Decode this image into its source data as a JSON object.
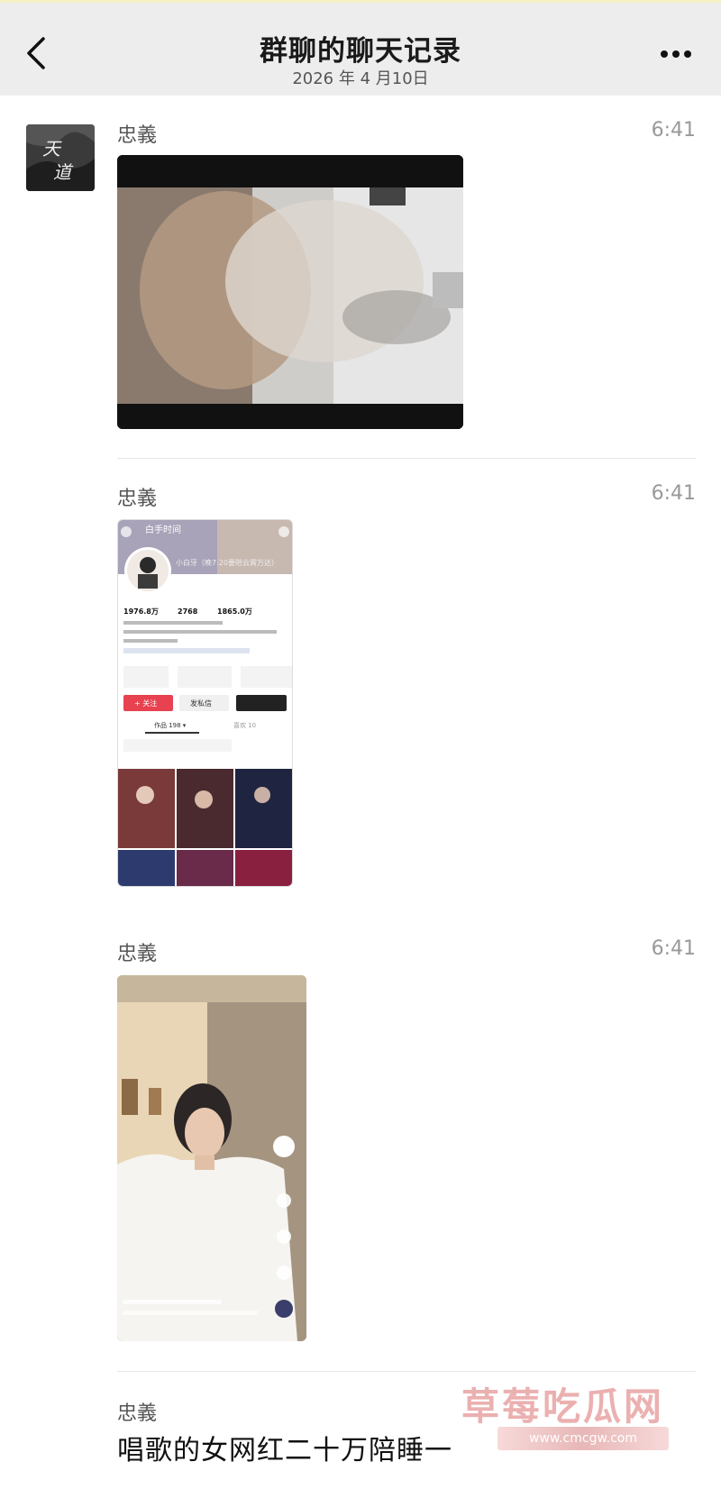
{
  "header": {
    "title": "群聊的聊天记录",
    "date": "2026 年 4 月10日"
  },
  "avatar": {
    "text": "天道"
  },
  "messages": [
    {
      "sender": "忠義",
      "time": "6:41",
      "type": "video"
    },
    {
      "sender": "忠義",
      "time": "6:41",
      "type": "image",
      "profile": {
        "banner_text": "白手时间",
        "name": "小白牙（晚7:20要陪云霄万达）",
        "stat1": "1976.8万",
        "stat2": "2768",
        "stat3": "1865.0万",
        "follow_btn": "+ 关注",
        "msg_btn": "发私信",
        "tab_works": "作品 198 ▾",
        "tab_like": "喜欢 10"
      }
    },
    {
      "sender": "忠義",
      "time": "6:41",
      "type": "image"
    },
    {
      "sender": "忠義",
      "text": "唱歌的女网红二十万陪睡一"
    }
  ],
  "watermark": {
    "title": "草莓吃瓜网",
    "url": "www.cmcgw.com"
  },
  "colors": {
    "header_bg": "#ededed",
    "accent_red": "#e8414f"
  }
}
